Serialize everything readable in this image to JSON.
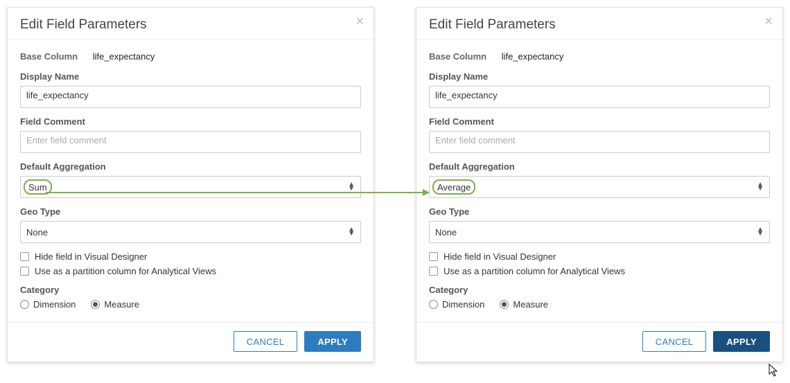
{
  "left": {
    "title": "Edit Field Parameters",
    "base_column_label": "Base Column",
    "base_column_value": "life_expectancy",
    "display_name_label": "Display Name",
    "display_name_value": "life_expectancy",
    "field_comment_label": "Field Comment",
    "field_comment_placeholder": "Enter field comment",
    "default_agg_label": "Default Aggregation",
    "default_agg_value": "Sum",
    "geo_type_label": "Geo Type",
    "geo_type_value": "None",
    "hide_field_label": "Hide field in Visual Designer",
    "partition_label": "Use as a partition column for Analytical Views",
    "category_label": "Category",
    "category_dimension": "Dimension",
    "category_measure": "Measure",
    "cancel": "CANCEL",
    "apply": "APPLY"
  },
  "right": {
    "title": "Edit Field Parameters",
    "base_column_label": "Base Column",
    "base_column_value": "life_expectancy",
    "display_name_label": "Display Name",
    "display_name_value": "life_expectancy",
    "field_comment_label": "Field Comment",
    "field_comment_placeholder": "Enter field comment",
    "default_agg_label": "Default Aggregation",
    "default_agg_value": "Average",
    "geo_type_label": "Geo Type",
    "geo_type_value": "None",
    "hide_field_label": "Hide field in Visual Designer",
    "partition_label": "Use as a partition column for Analytical Views",
    "category_label": "Category",
    "category_dimension": "Dimension",
    "category_measure": "Measure",
    "cancel": "CANCEL",
    "apply": "APPLY"
  }
}
